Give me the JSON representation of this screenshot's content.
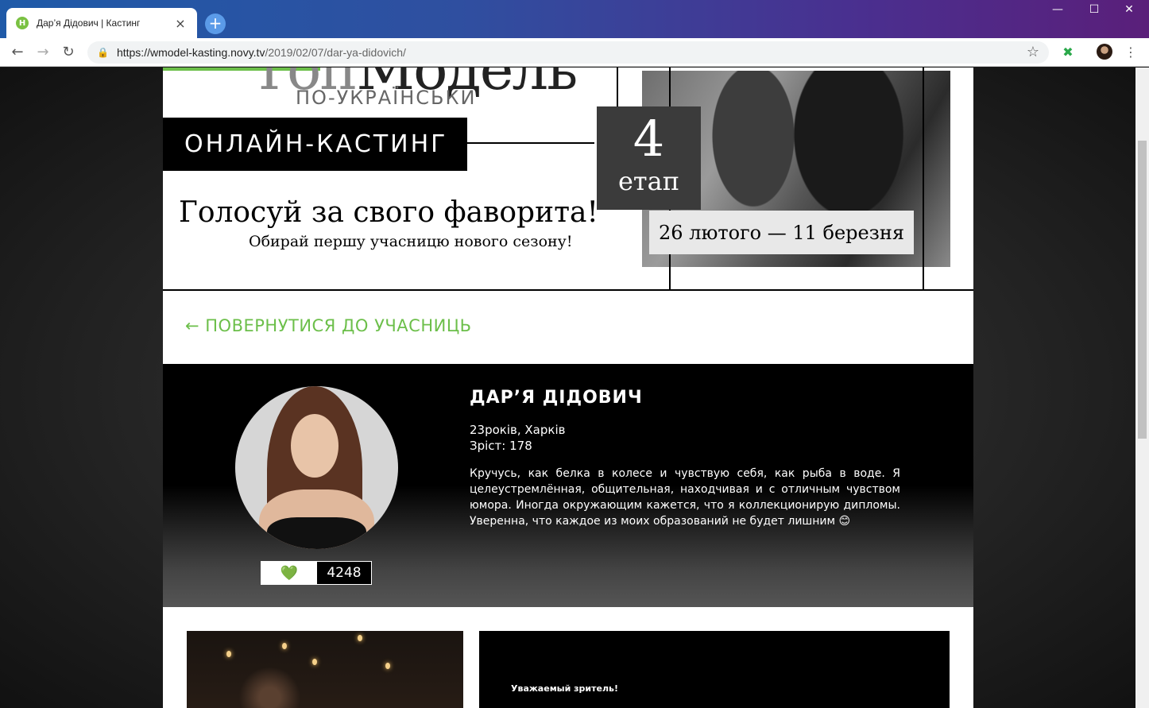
{
  "browser": {
    "tab_title": "Дар’я Дідович | Кастинг",
    "favicon_letter": "Н",
    "url_host": "https://wmodel-kasting.novy.tv",
    "url_path": "/2019/02/07/dar-ya-didovich/"
  },
  "banner": {
    "logo_text_gray": "Топ",
    "logo_text_dark": "Модель",
    "logo_sub": "ПО-УКРАЇНСЬКИ",
    "casting_label": "ОНЛАЙН-КАСТИНГ",
    "vote_title": "Голосуй за свого фаворита!",
    "vote_subtitle": "Обирай першу учасницю нового сезону!",
    "stage_number": "4",
    "stage_word": "етап",
    "dates": "26 лютого — 11 березня"
  },
  "back_link": "← ПОВЕРНУТИСЯ ДО УЧАСНИЦЬ",
  "profile": {
    "name": "ДАР’Я ДІДОВИЧ",
    "age_city": "23років, Харків",
    "height": "Зріст: 178",
    "bio": "Кручусь, как белка в колесе и чувствую себя, как рыба в воде. Я целеустремлённая, общительная, находчивая и с отличным чувством юмора. Иногда окружающим кажется, что я коллекционирую дипломы. Уверенна, что каждое из моих образований не будет лишним 😊",
    "like_icon": "green-heart-icon",
    "votes": "4248"
  },
  "lower": {
    "dear_viewer": "Уважаемый зритель!"
  },
  "colors": {
    "accent_green": "#6cbf4a"
  }
}
